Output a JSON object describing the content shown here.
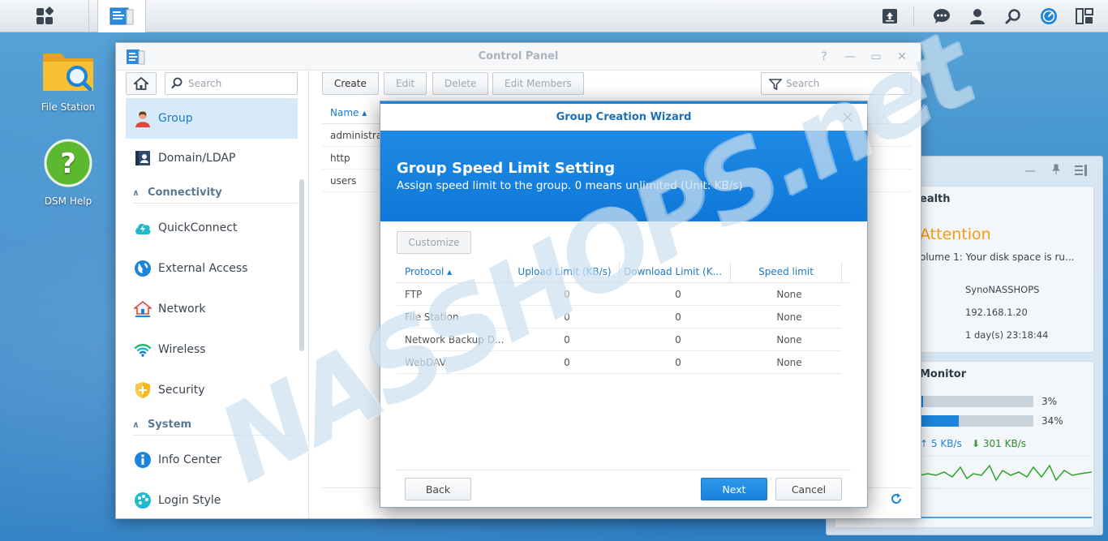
{
  "desktop": {
    "icons": [
      {
        "label": "File Station"
      },
      {
        "label": "DSM Help"
      }
    ]
  },
  "control_panel": {
    "title": "Control Panel",
    "sidebar": {
      "search_placeholder": "Search",
      "items": {
        "group": "Group",
        "domain": "Domain/LDAP",
        "connectivity_section": "Connectivity",
        "quickconnect": "QuickConnect",
        "external_access": "External Access",
        "network": "Network",
        "wireless": "Wireless",
        "security": "Security",
        "system_section": "System",
        "info_center": "Info Center",
        "login_style": "Login Style"
      }
    },
    "toolbar": {
      "create": "Create",
      "edit": "Edit",
      "delete": "Delete",
      "edit_members": "Edit Members",
      "search_placeholder": "Search"
    },
    "table": {
      "header_name": "Name ▴",
      "rows": [
        "administrat",
        "http",
        "users"
      ]
    }
  },
  "widget": {
    "health_title": "ealth",
    "attention": "Attention",
    "volume_msg": "olume 1: Your disk space is ru...",
    "server_name": "SynoNASSHOPS",
    "ip": "192.168.1.20",
    "uptime": "1 day(s) 23:18:44",
    "monitor_title": "Monitor",
    "cpu_percent_label": "3%",
    "ram_percent_label": "34%",
    "cpu_percent": 3,
    "ram_percent": 34,
    "upload": "5 KB/s",
    "download": "301 KB/s"
  },
  "wizard": {
    "title": "Group Creation Wizard",
    "banner_title": "Group Speed Limit Setting",
    "banner_subtitle": "Assign speed limit to the group. 0 means unlimited (Unit: KB/s)",
    "customize": "Customize",
    "columns": {
      "protocol": "Protocol ▴",
      "upload": "Upload Limit (KB/s)",
      "download": "Download Limit (K...",
      "speed": "Speed limit"
    },
    "rows": [
      {
        "protocol": "FTP",
        "upload": "0",
        "download": "0",
        "speed": "None"
      },
      {
        "protocol": "File Station",
        "upload": "0",
        "download": "0",
        "speed": "None"
      },
      {
        "protocol": "Network Backup D...",
        "upload": "0",
        "download": "0",
        "speed": "None"
      },
      {
        "protocol": "WebDAV",
        "upload": "0",
        "download": "0",
        "speed": "None"
      }
    ],
    "back": "Back",
    "next": "Next",
    "cancel": "Cancel"
  },
  "watermark": "NASSHOPS.net",
  "colors": {
    "accent": "#1b84db",
    "selected_bg": "#d6eafa",
    "attention": "#f39c12"
  }
}
